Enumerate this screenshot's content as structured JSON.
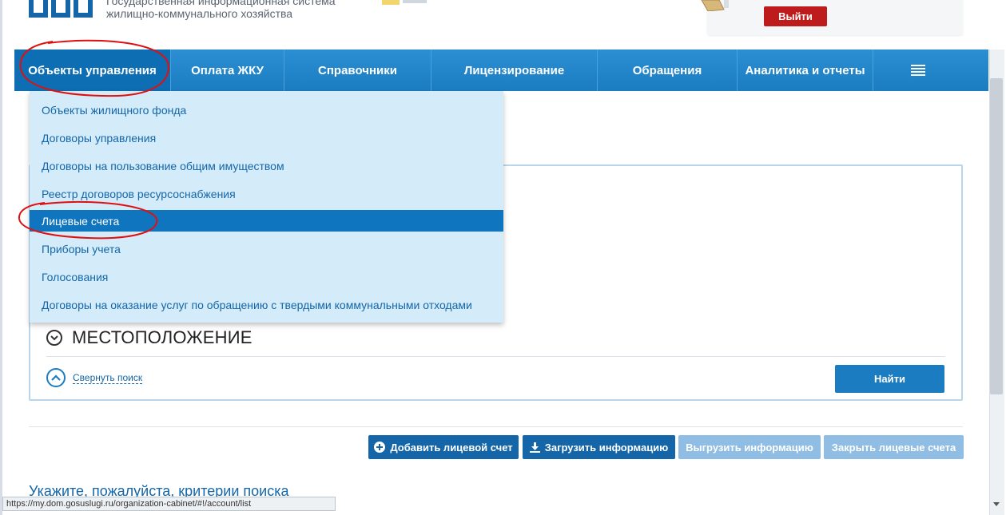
{
  "header": {
    "title_line1": "Государственная информационная система",
    "title_line2": "жилищно-коммунального хозяйства",
    "logout_label": "Выйти"
  },
  "nav": {
    "items": [
      {
        "label": "Объекты управления",
        "active": true
      },
      {
        "label": "Оплата ЖКУ"
      },
      {
        "label": "Справочники"
      },
      {
        "label": "Лицензирование"
      },
      {
        "label": "Обращения"
      },
      {
        "label": "Аналитика и отчеты"
      }
    ],
    "menu_icon": "hamburger-icon"
  },
  "dropdown": {
    "items": [
      {
        "label": "Объекты жилищного фонда"
      },
      {
        "label": "Договоры управления"
      },
      {
        "label": "Договоры на пользование общим имуществом"
      },
      {
        "label": "Реестр договоров ресурсоснабжения"
      },
      {
        "label": "Лицевые счета",
        "selected": true
      },
      {
        "label": "Приборы учета"
      },
      {
        "label": "Голосования"
      },
      {
        "label": "Договоры на оказание услуг по обращению с твердыми коммунальными отходами"
      }
    ]
  },
  "search_panel": {
    "section_title": "МЕСТОПОЛОЖЕНИЕ",
    "collapse_label": "Свернуть поиск",
    "find_label": "Найти"
  },
  "actions": {
    "add_account": "Добавить лицевой счет",
    "upload_info": "Загрузить информацию",
    "download_info": "Выгрузить информацию",
    "close_accounts": "Закрыть лицевые счета"
  },
  "main": {
    "criteria_text": "Укажите, пожалуйста, критерии поиска"
  },
  "status_bar": {
    "url": "https://my.dom.gosuslugi.ru/organization-cabinet/#!/account/list"
  },
  "colors": {
    "nav_blue": "#1b7cc1",
    "dropdown_bg": "#d4ecfa",
    "logout_red": "#be1c1c",
    "annotation_red": "#e01010"
  }
}
